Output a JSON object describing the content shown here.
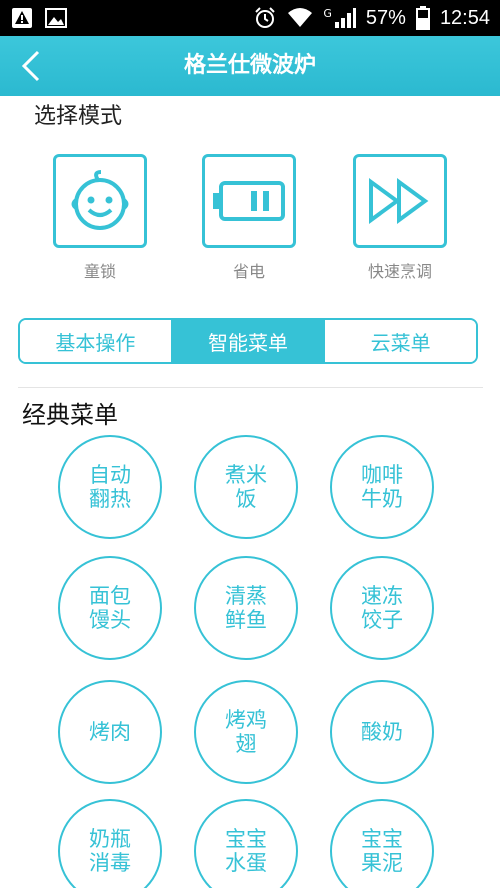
{
  "status_bar": {
    "network": "G",
    "battery": "57%",
    "time": "12:54"
  },
  "header": {
    "title": "格兰仕微波炉"
  },
  "select_mode": {
    "title": "选择模式",
    "modes": [
      {
        "label": "童锁",
        "icon": "baby-face-icon"
      },
      {
        "label": "省电",
        "icon": "battery-icon"
      },
      {
        "label": "快速烹调",
        "icon": "fast-forward-icon"
      }
    ]
  },
  "tabs": [
    {
      "label": "基本操作",
      "active": false
    },
    {
      "label": "智能菜单",
      "active": true
    },
    {
      "label": "云菜单",
      "active": false
    }
  ],
  "classic_menu": {
    "title": "经典菜单",
    "items": [
      "自动翻热",
      "煮米饭",
      "咖啡牛奶",
      "面包馒头",
      "清蒸鲜鱼",
      "速冻饺子",
      "烤肉",
      "烤鸡翅",
      "酸奶",
      "奶瓶消毒",
      "宝宝水蛋",
      "宝宝果泥"
    ]
  },
  "colors": {
    "accent": "#36c2d6",
    "header": "#2bb9d0",
    "label_gray": "#888888"
  }
}
